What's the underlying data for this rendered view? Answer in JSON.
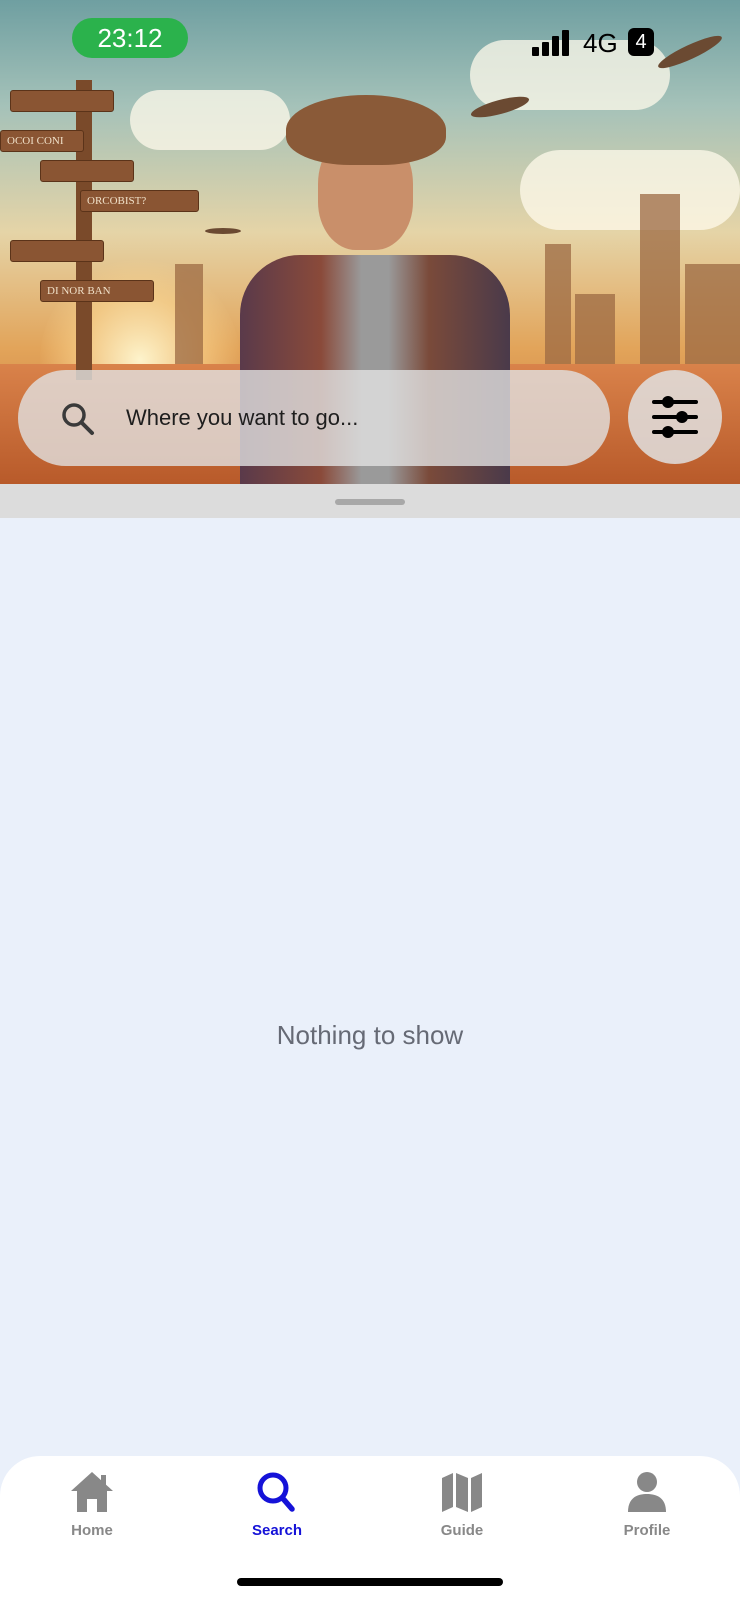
{
  "status_bar": {
    "time": "23:12",
    "network": "4G",
    "battery": "4",
    "time_pill_color": "#2BB24C"
  },
  "hero": {
    "image": "traveler-with-map-and-signpost",
    "signs": [
      "ORCOBIST?",
      "DI NOR BAN",
      "OCOI CONI"
    ]
  },
  "search": {
    "placeholder": "Where you want to go...",
    "icon": "search-icon",
    "filter_icon": "sliders-icon"
  },
  "content": {
    "empty_message": "Nothing to show"
  },
  "tab_bar": {
    "active_color": "#1512D8",
    "inactive_color": "#888888",
    "tabs": [
      {
        "label": "Home",
        "icon": "home-icon",
        "active": false
      },
      {
        "label": "Search",
        "icon": "search-icon",
        "active": true
      },
      {
        "label": "Guide",
        "icon": "map-icon",
        "active": false
      },
      {
        "label": "Profile",
        "icon": "person-icon",
        "active": false
      }
    ]
  }
}
